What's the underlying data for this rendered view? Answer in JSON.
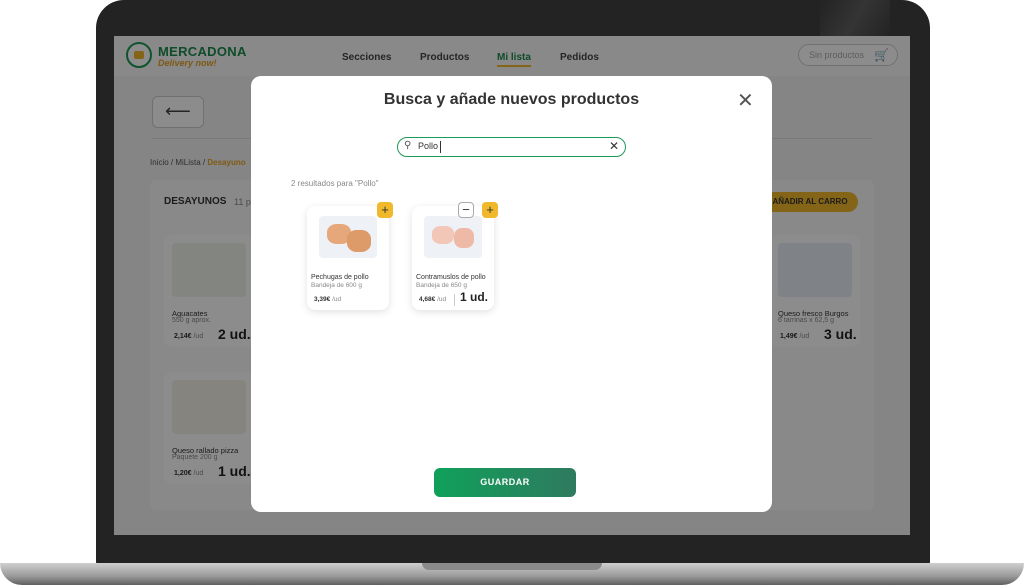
{
  "app": {
    "brand_name": "MERCADONA",
    "brand_tagline": "Delivery now!",
    "nav": [
      "Secciones",
      "Productos",
      "Mi lista",
      "Pedidos"
    ],
    "nav_active": "Mi lista",
    "cart_placeholder": "Sin productos",
    "breadcrumb": {
      "home": "Inicio",
      "list": "MiLista",
      "current": "Desayuno"
    },
    "section_title": "DESAYUNOS",
    "section_count": "11 p",
    "add_to_cart_label": "AÑADIR AL CARRO",
    "products": [
      {
        "name": "Aguacates",
        "detail": "550 g aprox.",
        "price": "2,14€",
        "unit": "/ud",
        "qty": "2 ud."
      },
      {
        "name": "Queso fresco Burgos",
        "detail": "6 tarrinas x 62,5 g",
        "price": "1,49€",
        "unit": "/ud",
        "qty": "3 ud."
      },
      {
        "name": "Queso rallado pizza",
        "detail": "Paquete 200 g",
        "price": "1,20€",
        "unit": "/ud",
        "qty": "1 ud."
      }
    ]
  },
  "modal": {
    "title": "Busca y añade nuevos productos",
    "search_value": "Pollo",
    "results_text": "2 resultados para \"Pollo\"",
    "results": [
      {
        "name": "Pechugas de pollo",
        "detail": "Bandeja de 600 g",
        "price": "3,39€",
        "unit": "/ud",
        "qty": ""
      },
      {
        "name": "Contramuslos de pollo",
        "detail": "Bandeja de 650 g",
        "price": "4,68€",
        "unit": "/ud",
        "qty": "1 ud."
      }
    ],
    "save_label": "GUARDAR"
  },
  "icons": {
    "close": "close-icon",
    "search": "search-icon",
    "clear": "clear-icon",
    "cart": "cart-icon",
    "back": "back-arrow-icon"
  },
  "colors": {
    "brand_green": "#1d8a4b",
    "accent_yellow": "#f0b92c",
    "save_gradient_start": "#0fa15a",
    "save_gradient_end": "#2f7a5f"
  }
}
